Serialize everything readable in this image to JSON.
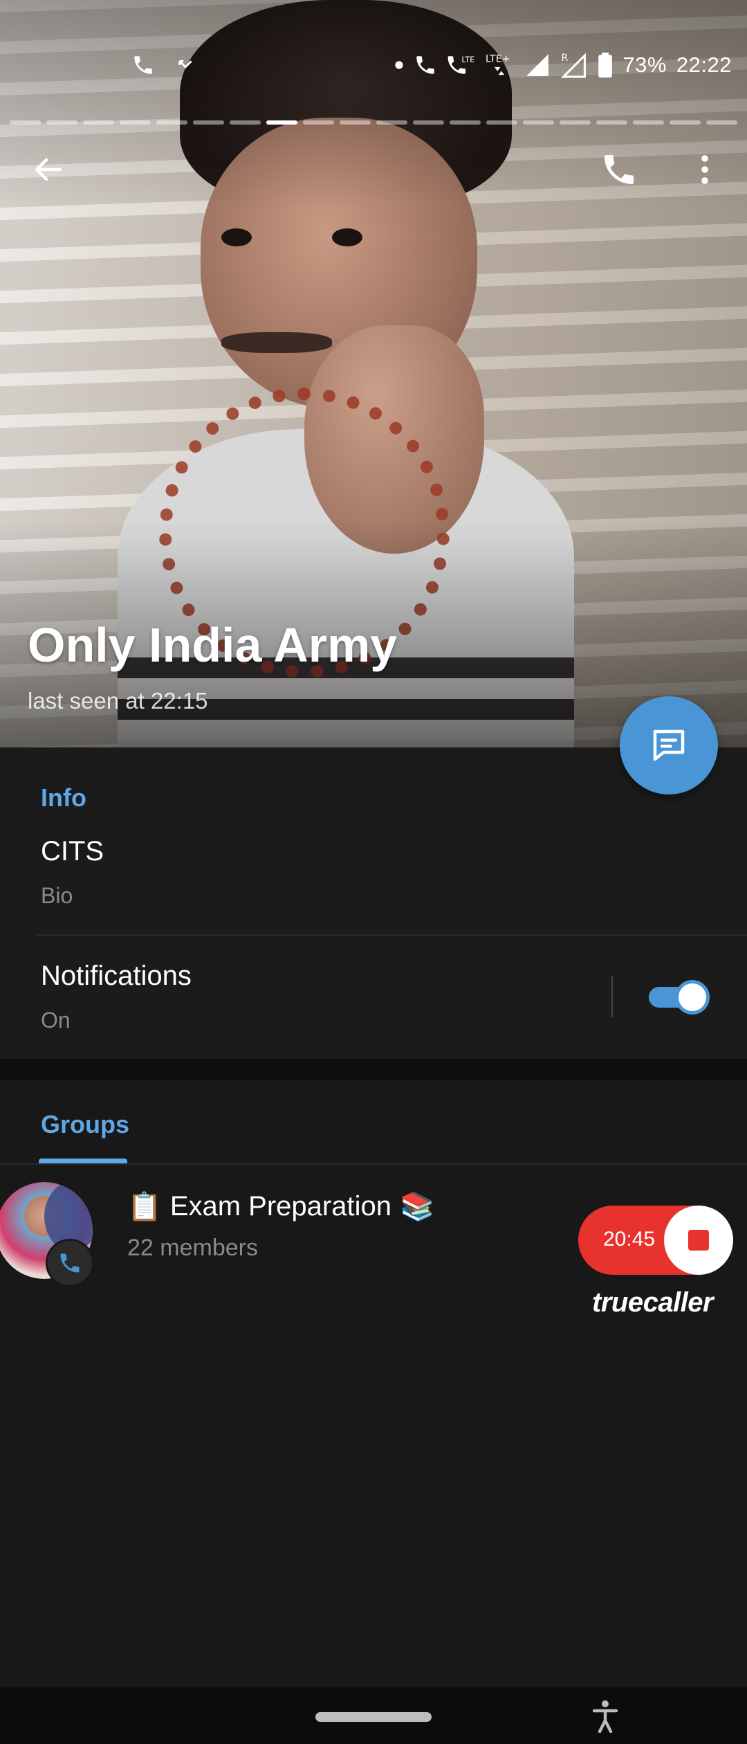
{
  "status_bar": {
    "battery": "73%",
    "time": "22:22",
    "network_labels": [
      "LTE",
      "LTE+",
      "R"
    ]
  },
  "profile": {
    "name": "Only India Army",
    "last_seen": "last seen at 22:15"
  },
  "story_progress": {
    "total": 20,
    "active_index": 7
  },
  "info": {
    "section_title": "Info",
    "bio_value": "CITS",
    "bio_label": "Bio",
    "notifications_label": "Notifications",
    "notifications_value": "On",
    "notifications_enabled": true
  },
  "groups": {
    "tab_label": "Groups",
    "items": [
      {
        "title": "Exam Preparation",
        "prefix_emoji": "📋",
        "suffix_emoji": "📚",
        "members": "22 members"
      }
    ]
  },
  "truecaller": {
    "timer": "20:45",
    "brand": "truecaller"
  },
  "colors": {
    "accent": "#5fa8e8",
    "fab": "#4a95d6",
    "background": "#181818",
    "record_red": "#e8322e"
  },
  "icons": [
    "back-arrow-icon",
    "phone-icon",
    "more-vert-icon",
    "chat-icon",
    "call-badge-icon",
    "accessibility-icon"
  ]
}
